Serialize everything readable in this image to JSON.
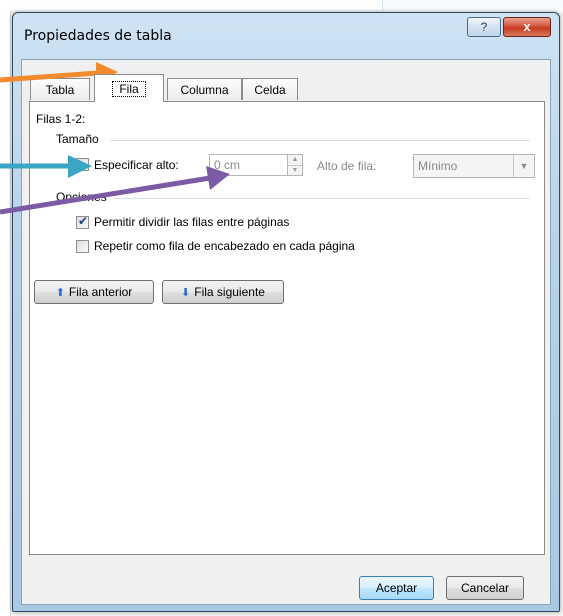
{
  "dialog": {
    "title": "Propiedades de tabla",
    "help_label": "?",
    "close_label": "x"
  },
  "tabs": [
    {
      "label": "Tabla",
      "selected": false
    },
    {
      "label": "Fila",
      "selected": true
    },
    {
      "label": "Columna",
      "selected": false
    },
    {
      "label": "Celda",
      "selected": false
    }
  ],
  "fila": {
    "rows_label": "Filas 1-2:",
    "size_group": "Tamaño",
    "specify_height_label": "Especificar alto:",
    "specify_height_checked": false,
    "height_value": "0 cm",
    "row_height_label": "Alto de fila:",
    "row_height_value": "Mínimo",
    "options_group": "Opciones",
    "allow_break_label": "Permitir dividir las filas entre páginas",
    "allow_break_checked": true,
    "repeat_header_label": "Repetir como fila de encabezado en cada página",
    "repeat_header_checked": false,
    "prev_row_label": "Fila anterior",
    "next_row_label": "Fila siguiente"
  },
  "footer": {
    "ok_label": "Aceptar",
    "cancel_label": "Cancelar"
  },
  "icons": {
    "up_arrow": "up-arrow-icon",
    "down_arrow": "down-arrow-icon"
  },
  "annotation_colors": {
    "orange": "#f28a2e",
    "teal": "#3aa6c4",
    "purple": "#7d5aa6"
  }
}
